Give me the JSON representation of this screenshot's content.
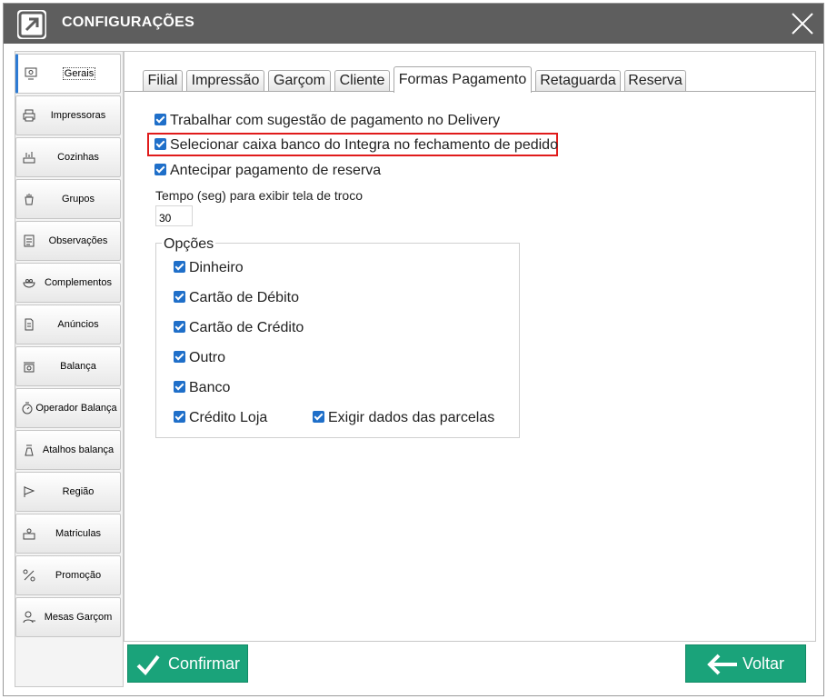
{
  "window": {
    "title": "CONFIGURAÇÕES"
  },
  "sidebar": {
    "items": [
      {
        "label": "Gerais",
        "icon": "settings-monitor-icon",
        "active": true
      },
      {
        "label": "Impressoras",
        "icon": "printer-icon"
      },
      {
        "label": "Cozinhas",
        "icon": "kitchen-icon"
      },
      {
        "label": "Grupos",
        "icon": "groups-icon"
      },
      {
        "label": "Observações",
        "icon": "clipboard-icon"
      },
      {
        "label": "Complementos",
        "icon": "bowl-icon"
      },
      {
        "label": "Anúncios",
        "icon": "document-icon"
      },
      {
        "label": "Balança",
        "icon": "scale-icon"
      },
      {
        "label": "Operador  Balança",
        "icon": "scale-operator-icon"
      },
      {
        "label": "Atalhos balança",
        "icon": "scale-shortcut-icon"
      },
      {
        "label": "Região",
        "icon": "flag-icon"
      },
      {
        "label": "Matriculas",
        "icon": "registration-icon"
      },
      {
        "label": "Promoção",
        "icon": "promotion-icon"
      },
      {
        "label": "Mesas Garçom",
        "icon": "waiter-icon"
      }
    ]
  },
  "tabs": [
    {
      "label": "Filial"
    },
    {
      "label": "Impressão"
    },
    {
      "label": "Garçom"
    },
    {
      "label": "Cliente"
    },
    {
      "label": "Formas Pagamento",
      "active": true
    },
    {
      "label": "Retaguarda"
    },
    {
      "label": "Reserva"
    }
  ],
  "options": {
    "delivery_suggestion": "Trabalhar com sugestão de pagamento no Delivery",
    "select_bank_cash": "Selecionar caixa banco do Integra no fechamento de pedido",
    "anticipate_reserve": "Antecipar pagamento de reserva",
    "change_time_label": "Tempo (seg) para exibir tela de troco",
    "change_time_value": "30"
  },
  "group": {
    "title": "Opções",
    "items": [
      "Dinheiro",
      "Cartão de Débito",
      "Cartão de Crédito",
      "Outro",
      "Banco",
      "Crédito Loja"
    ],
    "require_installments": "Exigir dados das parcelas"
  },
  "buttons": {
    "confirm": "Confirmar",
    "back": "Voltar"
  },
  "colors": {
    "titlebar": "#5e5e5e",
    "accent_green": "#1aa37a",
    "checkbox_blue": "#1f6fc9",
    "highlight_red": "#e01b1b"
  }
}
